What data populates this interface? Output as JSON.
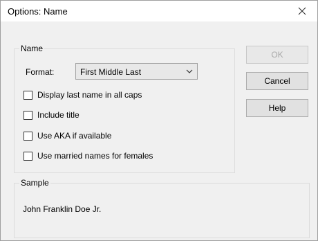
{
  "window": {
    "title": "Options: Name",
    "close_icon": "close-icon"
  },
  "name_group": {
    "legend": "Name",
    "format_label": "Format:",
    "format_value": "First Middle Last",
    "dropdown_icon": "chevron-down-icon",
    "checkboxes": [
      {
        "label": "Display last name in all caps",
        "checked": false
      },
      {
        "label": "Include title",
        "checked": false
      },
      {
        "label": "Use AKA if available",
        "checked": false
      },
      {
        "label": "Use married names for females",
        "checked": false
      }
    ]
  },
  "buttons": {
    "ok": "OK",
    "cancel": "Cancel",
    "help": "Help"
  },
  "sample_group": {
    "legend": "Sample",
    "text": "John Franklin Doe Jr."
  }
}
